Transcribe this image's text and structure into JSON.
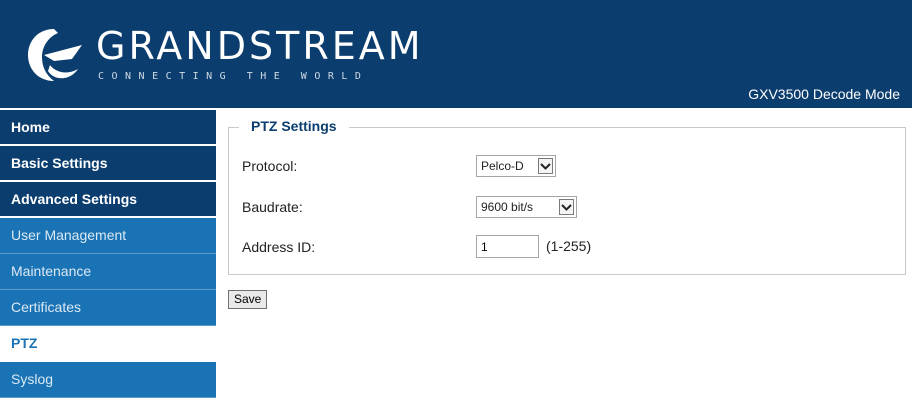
{
  "header": {
    "brand": "GRANDSTREAM",
    "tagline": "CONNECTING THE WORLD",
    "mode_title": "GXV3500 Decode Mode"
  },
  "sidebar": {
    "items": [
      {
        "label": "Home"
      },
      {
        "label": "Basic Settings"
      },
      {
        "label": "Advanced Settings"
      },
      {
        "label": "User Management"
      },
      {
        "label": "Maintenance"
      },
      {
        "label": "Certificates"
      },
      {
        "label": "PTZ"
      },
      {
        "label": "Syslog"
      }
    ]
  },
  "ptz": {
    "legend": "PTZ Settings",
    "protocol_label": "Protocol:",
    "protocol_value": "Pelco-D",
    "baudrate_label": "Baudrate:",
    "baudrate_value": "9600 bit/s",
    "address_label": "Address ID:",
    "address_value": "1",
    "address_range": "(1-255)"
  },
  "actions": {
    "save_label": "Save"
  },
  "colors": {
    "header_bg": "#0b3d6e",
    "sidebar_bg": "#1a73b4",
    "accent": "#1a73b4"
  }
}
